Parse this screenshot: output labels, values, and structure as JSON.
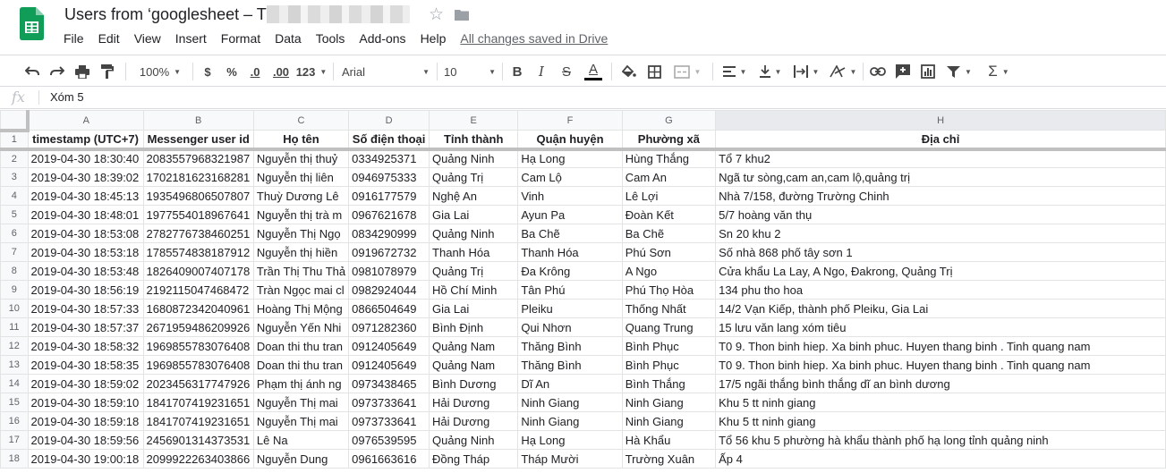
{
  "app": {
    "title": "Users from ‘googlesheet – T",
    "saved_status": "All changes saved in Drive",
    "brand_color": "#0f9d58"
  },
  "menu": [
    "File",
    "Edit",
    "View",
    "Insert",
    "Format",
    "Data",
    "Tools",
    "Add-ons",
    "Help"
  ],
  "toolbar": {
    "zoom": "100%",
    "currency": "$",
    "percent": "%",
    "decrease_decimals": ".0",
    "increase_decimals": ".00",
    "more_formats": "123",
    "font": "Arial",
    "font_size": "10",
    "bold": "B",
    "italic": "I",
    "strikethrough": "S",
    "text_color_letter": "A"
  },
  "formula": {
    "fx": "fx",
    "value": "Xóm 5"
  },
  "columns": [
    "A",
    "B",
    "C",
    "D",
    "E",
    "F",
    "G",
    "H"
  ],
  "header_row": {
    "number": "1",
    "cells": [
      "timestamp (UTC+7)",
      "Messenger user id",
      "Họ tên",
      "Số điện thoại",
      "Tỉnh thành",
      "Quận huyện",
      "Phường xã",
      "Địa chỉ"
    ]
  },
  "rows": [
    {
      "number": "2",
      "cells": [
        "2019-04-30 18:30:40",
        "2083557968321987",
        "Nguyễn thị thuỷ",
        "0334925371",
        "Quảng Ninh",
        "Hạ Long",
        "Hùng Thắng",
        "Tổ 7 khu2"
      ]
    },
    {
      "number": "3",
      "cells": [
        "2019-04-30 18:39:02",
        "1702181623168281",
        "Nguyễn thị liên",
        "0946975333",
        "Quảng Trị",
        "Cam Lộ",
        "Cam An",
        "Ngã tư sòng,cam an,cam lộ,quảng trị"
      ]
    },
    {
      "number": "4",
      "cells": [
        "2019-04-30 18:45:13",
        "1935496806507807",
        "Thuỳ Dương Lê",
        "0916177579",
        "Nghệ An",
        "Vinh",
        "Lê Lợi",
        "Nhà 7/158, đường Trường Chinh"
      ]
    },
    {
      "number": "5",
      "cells": [
        "2019-04-30 18:48:01",
        "1977554018967641",
        "Nguyễn thị trà m",
        "0967621678",
        "Gia Lai",
        "Ayun Pa",
        "Đoàn Kết",
        "5/7 hoàng văn thụ"
      ]
    },
    {
      "number": "6",
      "cells": [
        "2019-04-30 18:53:08",
        "2782776738460251",
        "Nguyễn Thị Ngọ",
        "0834290999",
        "Quảng Ninh",
        "Ba Chẽ",
        "Ba Chẽ",
        "Sn 20 khu 2"
      ]
    },
    {
      "number": "7",
      "cells": [
        "2019-04-30 18:53:18",
        "1785574838187912",
        "Nguyễn thị hiền",
        "0919672732",
        "Thanh Hóa",
        "Thanh Hóa",
        "Phú Sơn",
        "Số nhà 868 phố tây sơn 1"
      ]
    },
    {
      "number": "8",
      "cells": [
        "2019-04-30 18:53:48",
        "1826409007407178",
        "Trần Thị Thu Thả",
        "0981078979",
        "Quảng Trị",
        "Đa Krông",
        "A Ngo",
        "Cửa khẩu La Lay, A Ngo, Đakrong, Quảng Trị"
      ]
    },
    {
      "number": "9",
      "cells": [
        "2019-04-30 18:56:19",
        "2192115047468472",
        "Tràn Ngọc mai cl",
        "0982924044",
        "Hồ Chí Minh",
        "Tân Phú",
        "Phú Thọ Hòa",
        "134 phu tho hoa"
      ]
    },
    {
      "number": "10",
      "cells": [
        "2019-04-30 18:57:33",
        "1680872342040961",
        "Hoàng Thị Mộng",
        "0866504649",
        "Gia Lai",
        "Pleiku",
        "Thống Nhất",
        "14/2 Vạn Kiếp, thành phố Pleiku, Gia Lai"
      ]
    },
    {
      "number": "11",
      "cells": [
        "2019-04-30 18:57:37",
        "2671959486209926",
        "Nguyễn Yến Nhi",
        "0971282360",
        "Bình Định",
        "Qui Nhơn",
        "Quang Trung",
        "15 lưu văn lang xóm tiêu"
      ]
    },
    {
      "number": "12",
      "cells": [
        "2019-04-30 18:58:32",
        "1969855783076408",
        "Doan thi thu tran",
        "0912405649",
        "Quảng Nam",
        "Thăng Bình",
        "Bình Phục",
        "T0 9. Thon binh hiep. Xa binh phuc. Huyen thang binh . Tinh quang nam"
      ]
    },
    {
      "number": "13",
      "cells": [
        "2019-04-30 18:58:35",
        "1969855783076408",
        "Doan thi thu tran",
        "0912405649",
        "Quảng Nam",
        "Thăng Bình",
        "Bình Phục",
        "T0 9. Thon binh hiep. Xa binh phuc. Huyen thang binh . Tinh quang nam"
      ]
    },
    {
      "number": "14",
      "cells": [
        "2019-04-30 18:59:02",
        "2023456317747926",
        "Phạm thị ánh ng",
        "0973438465",
        "Bình Dương",
        "Dĩ An",
        "Bình Thắng",
        "17/5 ngãi thắng bình thắng dĩ an bình dương"
      ]
    },
    {
      "number": "15",
      "cells": [
        "2019-04-30 18:59:10",
        "1841707419231651",
        "Nguyễn Thị mai",
        "0973733641",
        "Hải Dương",
        "Ninh Giang",
        "Ninh Giang",
        "Khu 5 tt ninh giang"
      ]
    },
    {
      "number": "16",
      "cells": [
        "2019-04-30 18:59:18",
        "1841707419231651",
        "Nguyễn Thị mai",
        "0973733641",
        "Hải Dương",
        "Ninh Giang",
        "Ninh Giang",
        "Khu 5 tt ninh giang"
      ]
    },
    {
      "number": "17",
      "cells": [
        "2019-04-30 18:59:56",
        "2456901314373531",
        "Lê Na",
        "0976539595",
        "Quảng Ninh",
        "Hạ Long",
        "Hà Khẩu",
        "Tổ 56 khu 5 phường hà khẩu thành phố hạ long tỉnh quảng ninh"
      ]
    },
    {
      "number": "18",
      "cells": [
        "2019-04-30 19:00:18",
        "2099922263403866",
        "Nguyễn Dung",
        "0961663616",
        "Đồng Tháp",
        "Tháp Mười",
        "Trường Xuân",
        "Ấp 4"
      ]
    }
  ]
}
